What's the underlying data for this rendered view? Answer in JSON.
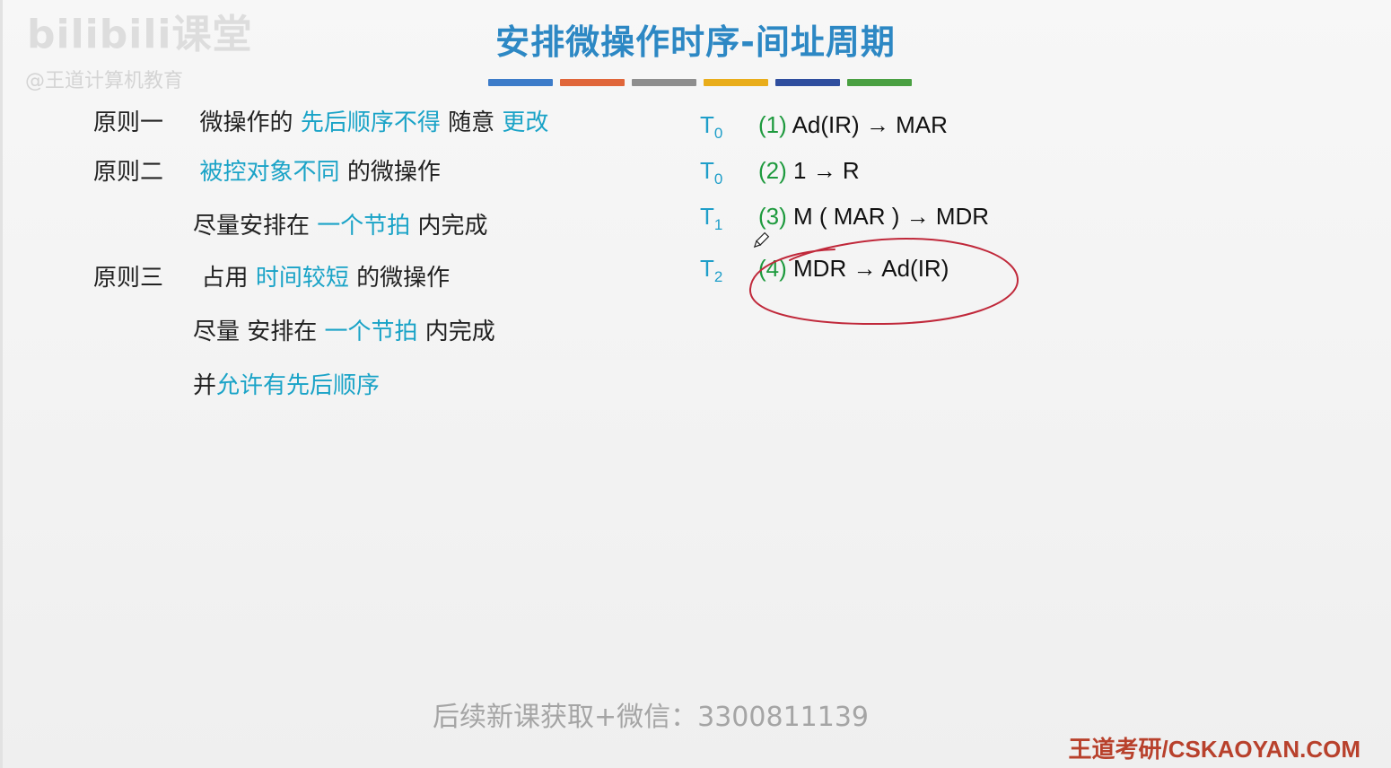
{
  "watermark": {
    "logo": "bilibili课堂",
    "sub": "@王道计算机教育"
  },
  "title": "安排微操作时序-间址周期",
  "color_bars": [
    "#3d7cc9",
    "#e0663a",
    "#8e8e8e",
    "#e9ad1b",
    "#2f4e9e",
    "#4aa042"
  ],
  "principles": [
    {
      "label": "原则一",
      "parts": [
        "微操作的 ",
        "先后顺序不得",
        " 随意 ",
        "更改"
      ]
    },
    {
      "label": "原则二",
      "parts": [
        "被控对象不同",
        " 的微操作"
      ]
    },
    {
      "label": "",
      "parts": [
        "尽量安排在 ",
        "一个节拍",
        " 内完成"
      ]
    },
    {
      "label": "原则三",
      "parts": [
        "占用 ",
        "时间较短",
        " 的微操作"
      ]
    },
    {
      "label": "",
      "parts": [
        "尽量 安排在 ",
        "一个节拍",
        " 内完成"
      ]
    },
    {
      "label": "",
      "parts": [
        "并",
        "允许有先后顺序"
      ]
    }
  ],
  "steps": [
    {
      "t": "T",
      "sub": "0",
      "num": "(1)",
      "text": " Ad(IR) → MAR"
    },
    {
      "t": "T",
      "sub": "0",
      "num": "(2)",
      "text": " 1 → R"
    },
    {
      "t": "T",
      "sub": "1",
      "num": "(3)",
      "text": " M ( MAR ) → MDR"
    },
    {
      "t": "T",
      "sub": "2",
      "num": "(4)",
      "text": " MDR → Ad(IR)"
    }
  ],
  "overlay": "后续新课获取+微信：3300811139",
  "footer": "王道考研/CSKAOYAN.COM",
  "annotation": {
    "color": "#c0283a"
  }
}
